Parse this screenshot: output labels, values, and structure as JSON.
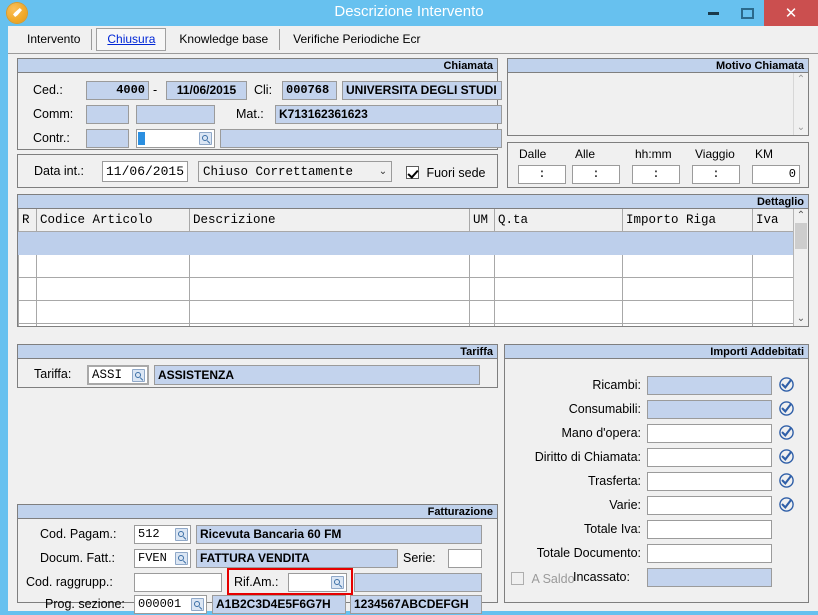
{
  "window": {
    "title": "Descrizione Intervento",
    "icon": "app-pen-icon",
    "buttons": {
      "minimize": "–",
      "maximize": "□",
      "close": "✕"
    },
    "accent_color": "#67c1ef",
    "close_color": "#cb4f4f"
  },
  "tabs": [
    {
      "label": "Intervento",
      "active": false
    },
    {
      "label": "Chiusura",
      "active": true
    },
    {
      "label": "Knowledge base",
      "active": false
    },
    {
      "label": "Verifiche Periodiche Ecr",
      "active": false
    }
  ],
  "chiamata": {
    "title": "Chiamata",
    "ced_label": "Ced.:",
    "ced_code": "4000",
    "separator": "-",
    "ced_date": "11/06/2015",
    "cli_label": "Cli:",
    "cli_code": "000768",
    "cli_name": "UNIVERSITA DEGLI STUDI",
    "comm_label": "Comm:",
    "comm_code": "",
    "comm_desc": "",
    "mat_label": "Mat.:",
    "mat_value": "K713162361623",
    "contr_label": "Contr.:",
    "contr_code": "",
    "contr_lookup": "",
    "contr_desc": ""
  },
  "motivo": {
    "title": "Motivo Chiamata",
    "text": "",
    "scroll_up": "⌃",
    "scroll_down": "⌄"
  },
  "data_int": {
    "label": "Data int.:",
    "value": "11/06/2015",
    "status_value": "Chiuso Correttamente",
    "status_chevron": "⌄",
    "fuori_sede_label": "Fuori sede",
    "fuori_sede_checked": true
  },
  "tempi": {
    "headers": [
      "Dalle",
      "Alle",
      "hh:mm",
      "Viaggio",
      "KM"
    ],
    "values": [
      ":",
      ":",
      ":",
      ":",
      "0"
    ]
  },
  "dettaglio": {
    "title": "Dettaglio",
    "columns": [
      "R",
      "Codice Articolo",
      "Descrizione",
      "UM",
      "Q.ta",
      "Importo Riga",
      "Iva"
    ],
    "rows": [
      {
        "selected": true,
        "cells": [
          "",
          "",
          "",
          "",
          "",
          "",
          ""
        ]
      },
      {
        "selected": false,
        "cells": [
          "",
          "",
          "",
          "",
          "",
          "",
          ""
        ]
      },
      {
        "selected": false,
        "cells": [
          "",
          "",
          "",
          "",
          "",
          "",
          ""
        ]
      },
      {
        "selected": false,
        "cells": [
          "",
          "",
          "",
          "",
          "",
          "",
          ""
        ]
      },
      {
        "selected": false,
        "cells": [
          "",
          "",
          "",
          "",
          "",
          "",
          ""
        ]
      }
    ],
    "scroll_up": "⌃",
    "scroll_down": "⌄"
  },
  "tariffa": {
    "title": "Tariffa",
    "label": "Tariffa:",
    "code": "ASSI",
    "description": "ASSISTENZA"
  },
  "fatturazione": {
    "title": "Fatturazione",
    "cod_pagam_label": "Cod. Pagam.:",
    "cod_pagam_code": "512",
    "cod_pagam_desc": "Ricevuta Bancaria 60 FM",
    "docum_fatt_label": "Docum. Fatt.:",
    "docum_fatt_code": "FVEN",
    "docum_fatt_desc": "FATTURA VENDITA",
    "serie_label": "Serie:",
    "serie_value": "",
    "cod_raggrupp_label": "Cod. raggrupp.:",
    "cod_raggrupp_value": "",
    "rif_am_label": "Rif.Am.:",
    "rif_am_value": "",
    "rif_am_desc": "",
    "rif_am_highlight_color": "#e60000",
    "prog_sezione_label": "Prog. sezione:",
    "prog_sezione_value": "000001",
    "prog_sezione_a": "A1B2C3D4E5F6G7H",
    "prog_sezione_b": "1234567ABCDEFGH"
  },
  "importi": {
    "title": "Importi Addebitati",
    "rows": [
      {
        "label": "Ricambi:",
        "value": "",
        "blue": true,
        "badge": true
      },
      {
        "label": "Consumabili:",
        "value": "",
        "blue": true,
        "badge": true
      },
      {
        "label": "Mano d'opera:",
        "value": "",
        "blue": false,
        "badge": true
      },
      {
        "label": "Diritto di Chiamata:",
        "value": "",
        "blue": false,
        "badge": true
      },
      {
        "label": "Trasferta:",
        "value": "",
        "blue": false,
        "badge": true
      },
      {
        "label": "Varie:",
        "value": "",
        "blue": false,
        "badge": true
      },
      {
        "label": "Totale Iva:",
        "value": "",
        "blue": false,
        "badge": false
      },
      {
        "label": "Totale Documento:",
        "value": "",
        "blue": false,
        "badge": false
      }
    ],
    "a_saldo_label": "A Saldo",
    "a_saldo_checked": false,
    "incassato_label": "Incassato:",
    "incassato_value": ""
  }
}
